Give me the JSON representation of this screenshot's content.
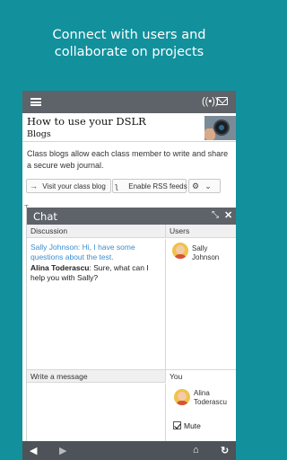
{
  "promo": {
    "line1": "Connect with users and",
    "line2": "collaborate on projects"
  },
  "topbar": {
    "menu_icon": "hamburger-icon",
    "icons": [
      "radio-signal-icon",
      "mail-icon"
    ]
  },
  "page": {
    "title": "How to use your DSLR",
    "subtitle": "Blogs",
    "description": "Class blogs allow each class member to write and share a secure web journal.",
    "buttons": {
      "visit": "Visit your class blog",
      "rss": "Enable RSS feeds"
    },
    "under_text": "T"
  },
  "chat": {
    "title": "Chat",
    "discussion_label": "Discussion",
    "users_label": "Users",
    "messages": [
      {
        "name": "Sally Johnson",
        "text": ": Hi, I have some questions about the test."
      },
      {
        "name": "Alina Toderascu",
        "text": ": Sure, what can I help you with Sally?"
      }
    ],
    "users": [
      {
        "name": "Sally Johnson"
      }
    ],
    "write_label": "Write a message",
    "you_label": "You",
    "you_name": "Alina Toderascu",
    "mute_label": "Mute",
    "mute_checked": true
  },
  "bottombar": {
    "icons": [
      "back-icon",
      "forward-icon",
      "home-icon",
      "refresh-icon"
    ]
  },
  "colors": {
    "background": "#12919d",
    "bar": "#5d6368",
    "link_message": "#3a8ed0"
  }
}
